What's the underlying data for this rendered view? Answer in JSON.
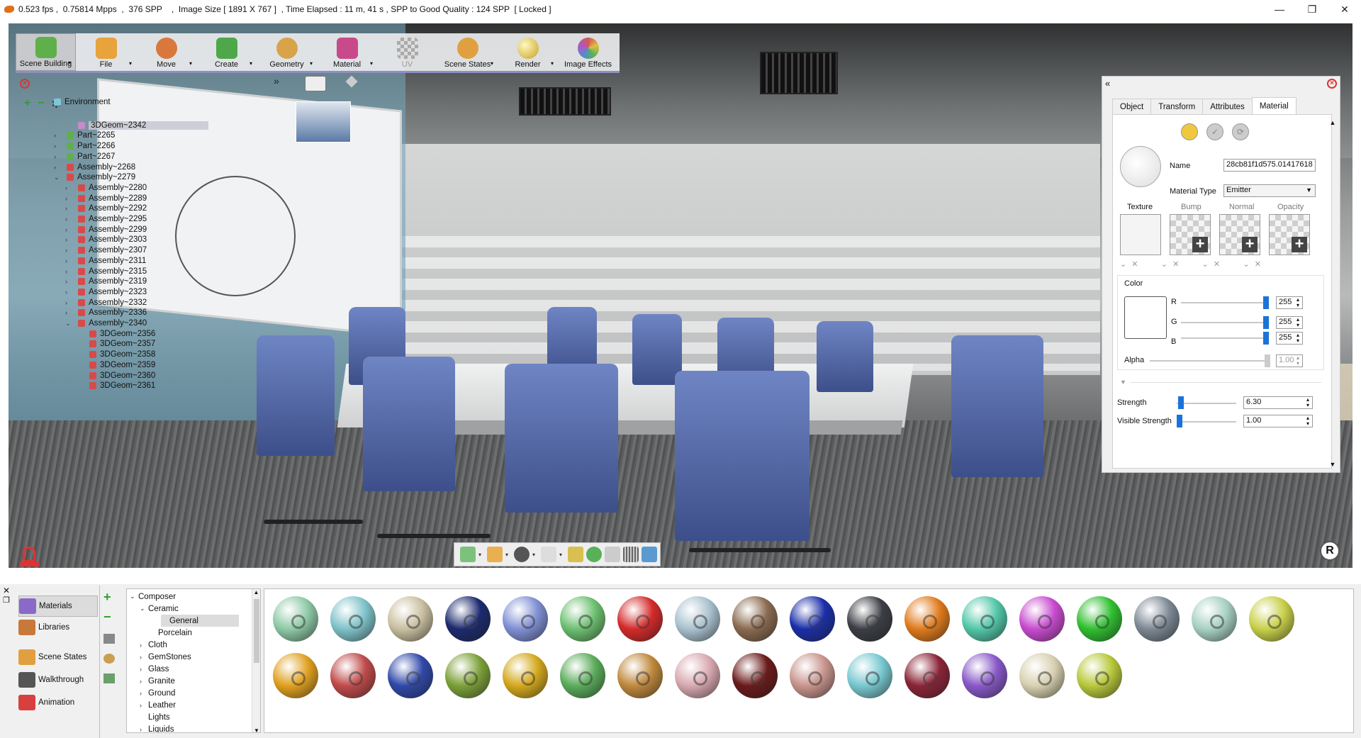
{
  "titlebar": {
    "text": "0.523 fps ,  0.75814 Mpps  ,  376 SPP    ,  Image Size [ 1891 X 767 ]  , Time Elapsed : 11 m, 41 s , SPP to Good Quality : 124 SPP  [ Locked ]",
    "minimize": "—",
    "maximize": "❐",
    "close": "✕"
  },
  "toolbar": [
    {
      "label": "Scene Building",
      "color": "#5fb04a",
      "active": true
    },
    {
      "label": "File",
      "color": "#e8a33a"
    },
    {
      "label": "Move",
      "color": "#d8783c"
    },
    {
      "label": "Create",
      "color": "#4ea84a"
    },
    {
      "label": "Geometry",
      "color": "#d9a34a"
    },
    {
      "label": "Material",
      "color": "#c84a8a"
    },
    {
      "label": "UV",
      "color": "#b0b0b0",
      "disabled": true
    },
    {
      "label": "Scene States",
      "color": "#e0a040"
    },
    {
      "label": "Render",
      "color": "#c9a020"
    },
    {
      "label": "Image Effects",
      "color": "#d05858"
    }
  ],
  "scene_tree": [
    {
      "label": "Environment",
      "indent": 0,
      "color": "#7bc8d8",
      "twisty": ""
    },
    {
      "label": "3DGeom~2342",
      "indent": 3,
      "color": "#c88ac8",
      "twisty": "",
      "selected": true
    },
    {
      "label": "Part~2265",
      "indent": 2,
      "color": "#5fb04a",
      "twisty": "›"
    },
    {
      "label": "Part~2266",
      "indent": 2,
      "color": "#5fb04a",
      "twisty": "›"
    },
    {
      "label": "Part~2267",
      "indent": 2,
      "color": "#5fb04a",
      "twisty": "›"
    },
    {
      "label": "Assembly~2268",
      "indent": 2,
      "color": "#d84a4a",
      "twisty": "›"
    },
    {
      "label": "Assembly~2279",
      "indent": 2,
      "color": "#d84a4a",
      "twisty": "⌄"
    },
    {
      "label": "Assembly~2280",
      "indent": 3,
      "color": "#d84a4a",
      "twisty": "›"
    },
    {
      "label": "Assembly~2289",
      "indent": 3,
      "color": "#d84a4a",
      "twisty": "›"
    },
    {
      "label": "Assembly~2292",
      "indent": 3,
      "color": "#d84a4a",
      "twisty": "›"
    },
    {
      "label": "Assembly~2295",
      "indent": 3,
      "color": "#d84a4a",
      "twisty": "›"
    },
    {
      "label": "Assembly~2299",
      "indent": 3,
      "color": "#d84a4a",
      "twisty": "›"
    },
    {
      "label": "Assembly~2303",
      "indent": 3,
      "color": "#d84a4a",
      "twisty": "›"
    },
    {
      "label": "Assembly~2307",
      "indent": 3,
      "color": "#d84a4a",
      "twisty": "›"
    },
    {
      "label": "Assembly~2311",
      "indent": 3,
      "color": "#d84a4a",
      "twisty": "›"
    },
    {
      "label": "Assembly~2315",
      "indent": 3,
      "color": "#d84a4a",
      "twisty": "›"
    },
    {
      "label": "Assembly~2319",
      "indent": 3,
      "color": "#d84a4a",
      "twisty": "›"
    },
    {
      "label": "Assembly~2323",
      "indent": 3,
      "color": "#d84a4a",
      "twisty": "›"
    },
    {
      "label": "Assembly~2332",
      "indent": 3,
      "color": "#d84a4a",
      "twisty": "›"
    },
    {
      "label": "Assembly~2336",
      "indent": 3,
      "color": "#d84a4a",
      "twisty": "›"
    },
    {
      "label": "Assembly~2340",
      "indent": 3,
      "color": "#d84a4a",
      "twisty": "⌄"
    },
    {
      "label": "3DGeom~2356",
      "indent": 4,
      "color": "#d84a4a",
      "twisty": ""
    },
    {
      "label": "3DGeom~2357",
      "indent": 4,
      "color": "#d84a4a",
      "twisty": ""
    },
    {
      "label": "3DGeom~2358",
      "indent": 4,
      "color": "#d84a4a",
      "twisty": ""
    },
    {
      "label": "3DGeom~2359",
      "indent": 4,
      "color": "#d84a4a",
      "twisty": ""
    },
    {
      "label": "3DGeom~2360",
      "indent": 4,
      "color": "#d84a4a",
      "twisty": ""
    },
    {
      "label": "3DGeom~2361",
      "indent": 4,
      "color": "#d84a4a",
      "twisty": ""
    }
  ],
  "props": {
    "tabs": [
      "Object",
      "Transform",
      "Attributes",
      "Material"
    ],
    "active_tab": "Material",
    "name_label": "Name",
    "name_value": "28cb81f1d575.01417618",
    "material_type_label": "Material Type",
    "material_type_value": "Emitter",
    "texture_slots": [
      "Texture",
      "Bump",
      "Normal",
      "Opacity"
    ],
    "color_label": "Color",
    "r_label": "R",
    "r_value": "255",
    "g_label": "G",
    "g_value": "255",
    "b_label": "B",
    "b_value": "255",
    "alpha_label": "Alpha",
    "alpha_value": "1.00",
    "strength_label": "Strength",
    "strength_value": "6.30",
    "visible_strength_label": "Visible Strength",
    "visible_strength_value": "1.00"
  },
  "side_nav": [
    {
      "label": "Materials",
      "color": "#8a6ac8",
      "active": true
    },
    {
      "label": "Libraries",
      "color": "#c8783a"
    },
    {
      "label": "Scene States",
      "color": "#e0a040"
    },
    {
      "label": "Walkthrough",
      "color": "#555555"
    },
    {
      "label": "Animation",
      "color": "#d84040"
    }
  ],
  "categories": [
    {
      "label": "Composer",
      "indent": 0,
      "twisty": "⌄"
    },
    {
      "label": "Ceramic",
      "indent": 1,
      "twisty": "⌄"
    },
    {
      "label": "General",
      "indent": 2,
      "twisty": "",
      "selected": true
    },
    {
      "label": "Porcelain",
      "indent": 2,
      "twisty": ""
    },
    {
      "label": "Cloth",
      "indent": 1,
      "twisty": "›"
    },
    {
      "label": "GemStones",
      "indent": 1,
      "twisty": "›"
    },
    {
      "label": "Glass",
      "indent": 1,
      "twisty": "›"
    },
    {
      "label": "Granite",
      "indent": 1,
      "twisty": "›"
    },
    {
      "label": "Ground",
      "indent": 1,
      "twisty": "›"
    },
    {
      "label": "Leather",
      "indent": 1,
      "twisty": "›"
    },
    {
      "label": "Lights",
      "indent": 1,
      "twisty": ""
    },
    {
      "label": "Liquids",
      "indent": 1,
      "twisty": "›"
    }
  ],
  "materials_row1": [
    "#8ec9a6",
    "#7ec2c9",
    "#c9bfa0",
    "#1c2a6e",
    "#7f8fd4",
    "#6cc070",
    "#d42a2a",
    "#a9c1cf",
    "#8a6a50",
    "#1b2ea8",
    "#3b3e44",
    "#e07a1c",
    "#52c7a8",
    "#c84ad0",
    "#2fbf2f",
    "#7c8894",
    "#a7d1c2",
    "#c8d048"
  ],
  "materials_row2": [
    "#e0a020",
    "#c04a4a",
    "#3048a8",
    "#7ca038",
    "#d4a81c",
    "#5aac5a",
    "#c0883c",
    "#d8a8b0",
    "#6a1a1a",
    "#c8948c",
    "#78c8d0",
    "#8a2438",
    "#8858c8",
    "#d8d0b0",
    "#b8c83a"
  ]
}
